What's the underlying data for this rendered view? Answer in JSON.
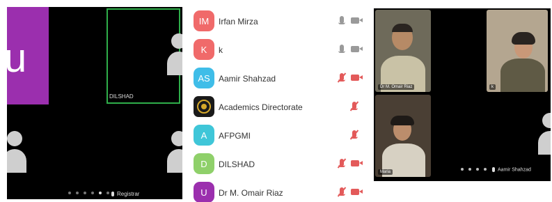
{
  "left_panel": {
    "tile_letter": "u",
    "tile_color": "#9b2fae",
    "speaking_border_color": "#2fae4a",
    "speaking_tile_name": "DILSHAD",
    "bottom_label": "Registrar",
    "page_dots": 6,
    "active_dot": 4
  },
  "participants": [
    {
      "initials": "IM",
      "name": "Irfan Mirza",
      "avatar_color": "#f06a6a",
      "mic": "on",
      "camera": "on"
    },
    {
      "initials": "K",
      "name": "k",
      "avatar_color": "#f06a6a",
      "mic": "on",
      "camera": "on"
    },
    {
      "initials": "AS",
      "name": "Aamir Shahzad",
      "avatar_color": "#3fbde8",
      "mic": "muted",
      "camera": "off"
    },
    {
      "initials": "",
      "name": "Academics Directorate",
      "avatar_color": "logo",
      "mic": "muted",
      "camera": "none"
    },
    {
      "initials": "A",
      "name": "AFPGMI",
      "avatar_color": "#3fc6d8",
      "mic": "muted",
      "camera": "none"
    },
    {
      "initials": "D",
      "name": "DILSHAD",
      "avatar_color": "#8fd06a",
      "mic": "muted",
      "camera": "off"
    },
    {
      "initials": "U",
      "name": "Dr M. Omair Riaz",
      "avatar_color": "#9b2fae",
      "mic": "muted",
      "camera": "off"
    }
  ],
  "right_panel": {
    "tiles": [
      {
        "label": "Dr M. Omair Riaz"
      },
      {
        "label": "k"
      },
      {
        "label": "Maria"
      }
    ],
    "bottom_label": "Aamir Shahzad",
    "page_dots": 4
  }
}
